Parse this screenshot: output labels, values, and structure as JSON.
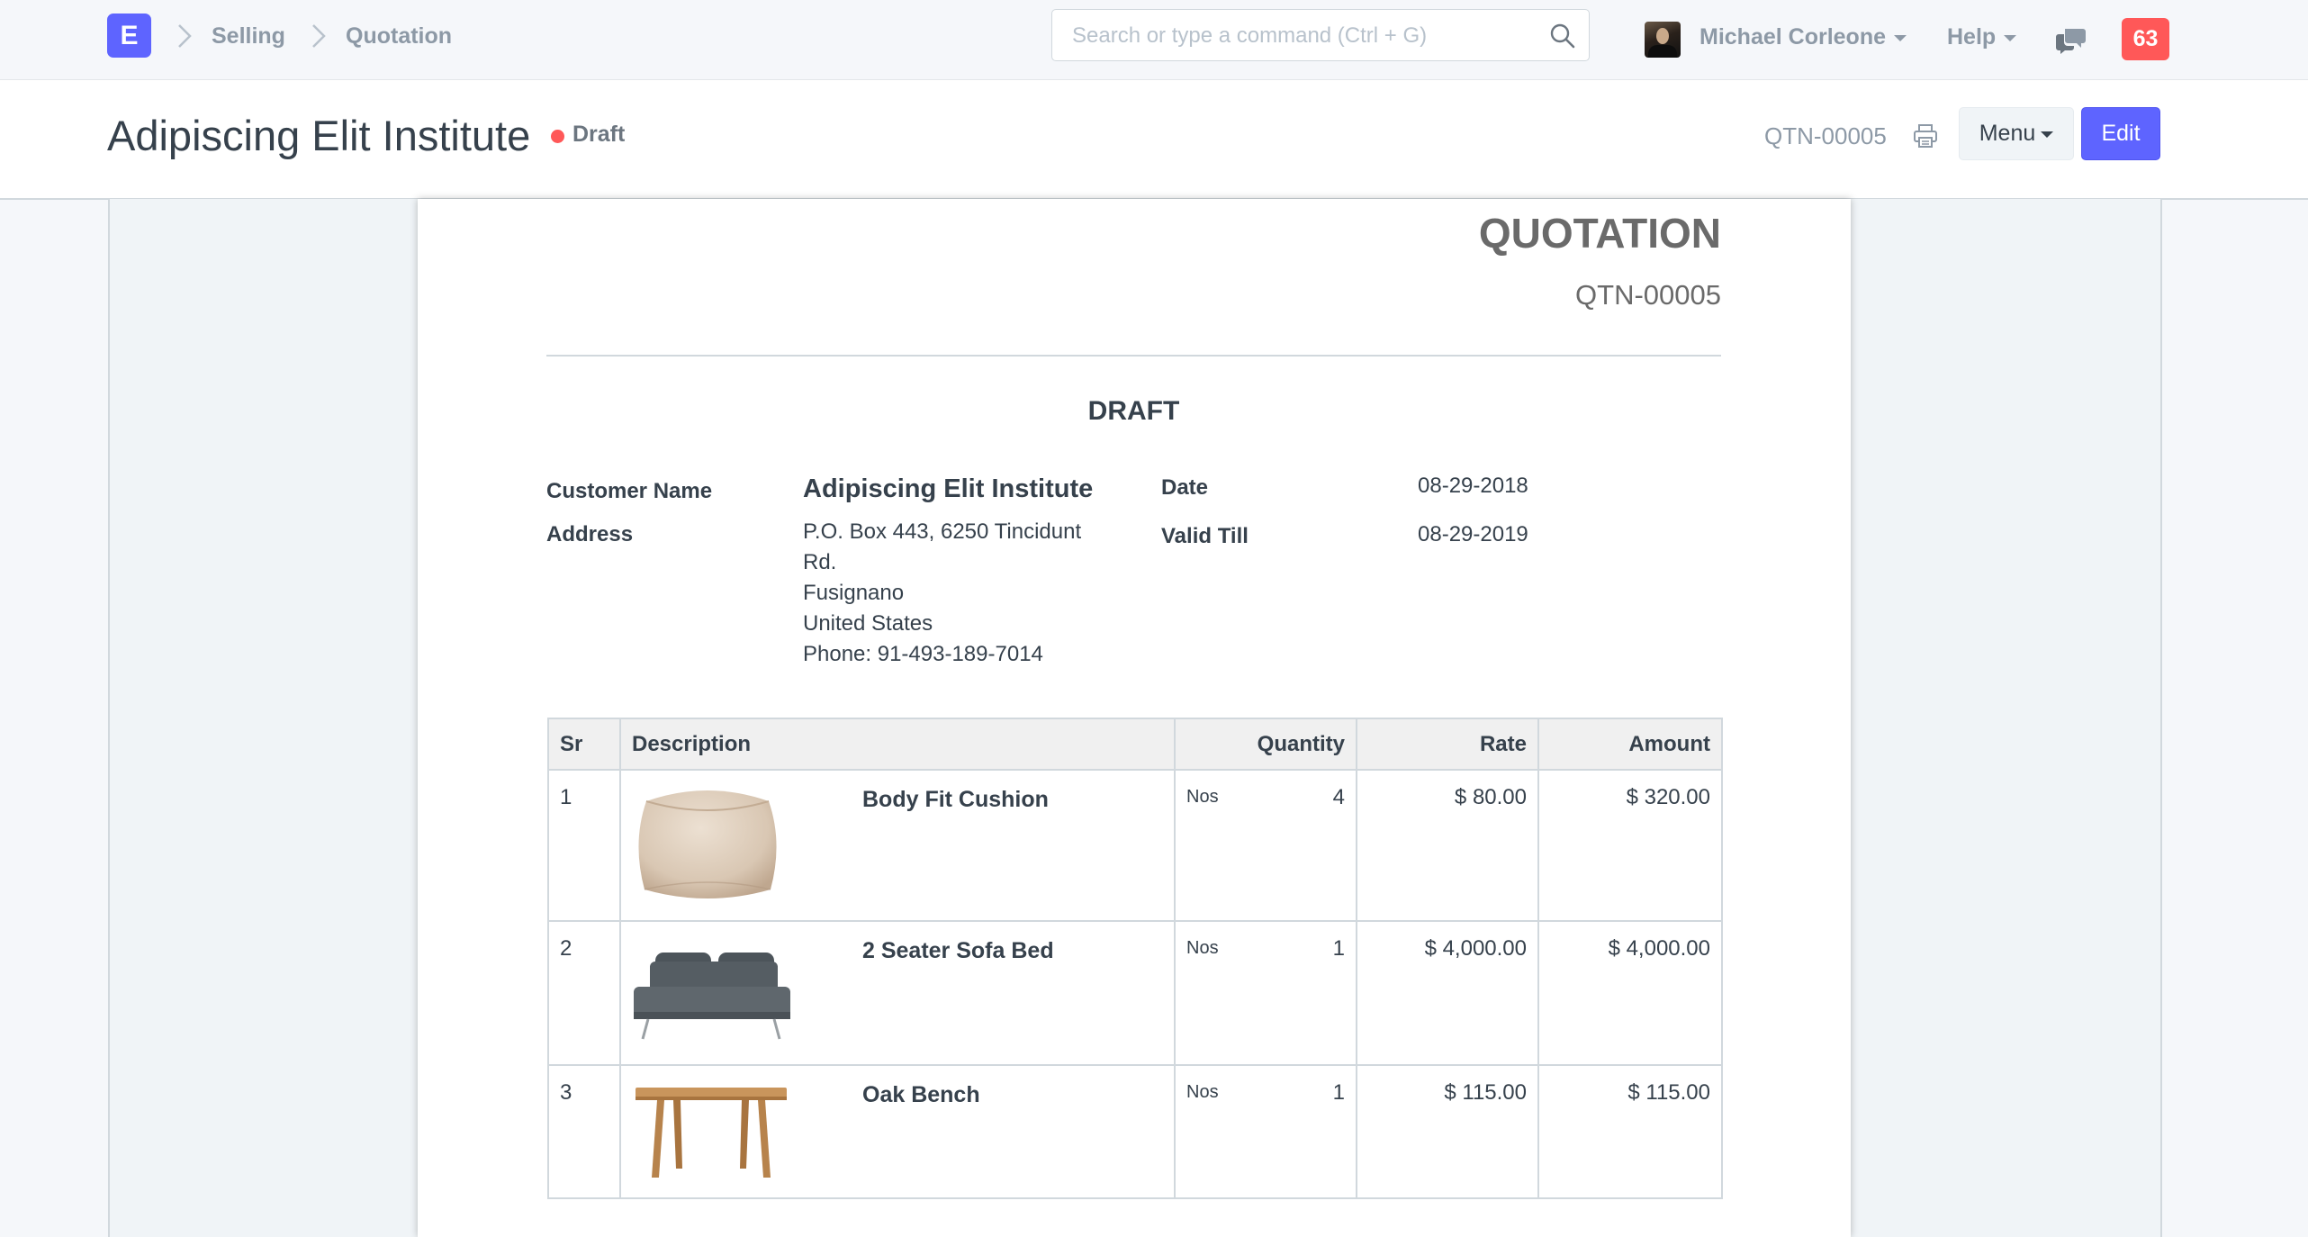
{
  "navbar": {
    "logo_letter": "E",
    "breadcrumbs": [
      "Selling",
      "Quotation"
    ],
    "search_placeholder": "Search or type a command (Ctrl + G)",
    "user_name": "Michael Corleone",
    "help_label": "Help",
    "notification_count": "63"
  },
  "page": {
    "title": "Adipiscing Elit Institute",
    "status": "Draft",
    "doc_name": "QTN-00005",
    "menu_label": "Menu",
    "edit_label": "Edit"
  },
  "print": {
    "heading": "QUOTATION",
    "number": "QTN-00005",
    "draft_label": "DRAFT",
    "customer_name_label": "Customer Name",
    "customer_name": "Adipiscing Elit Institute",
    "address_label": "Address",
    "address_lines": [
      "P.O. Box 443, 6250 Tincidunt",
      "Rd.",
      "Fusignano",
      "United States",
      "Phone: 91-493-189-7014"
    ],
    "date_label": "Date",
    "date": "08-29-2018",
    "valid_till_label": "Valid Till",
    "valid_till": "08-29-2019",
    "table": {
      "headers": {
        "sr": "Sr",
        "description": "Description",
        "quantity": "Quantity",
        "rate": "Rate",
        "amount": "Amount"
      },
      "rows": [
        {
          "sr": "1",
          "name": "Body Fit Cushion",
          "image": "cushion-image",
          "uom": "Nos",
          "qty": "4",
          "rate": "$ 80.00",
          "amount": "$ 320.00"
        },
        {
          "sr": "2",
          "name": "2 Seater Sofa Bed",
          "image": "sofa-image",
          "uom": "Nos",
          "qty": "1",
          "rate": "$ 4,000.00",
          "amount": "$ 4,000.00"
        },
        {
          "sr": "3",
          "name": "Oak Bench",
          "image": "bench-image",
          "uom": "Nos",
          "qty": "1",
          "rate": "$ 115.00",
          "amount": "$ 115.00"
        }
      ]
    }
  },
  "colors": {
    "accent": "#5e64ff",
    "status_red": "#ff5858",
    "muted_text": "#8d99a6"
  }
}
